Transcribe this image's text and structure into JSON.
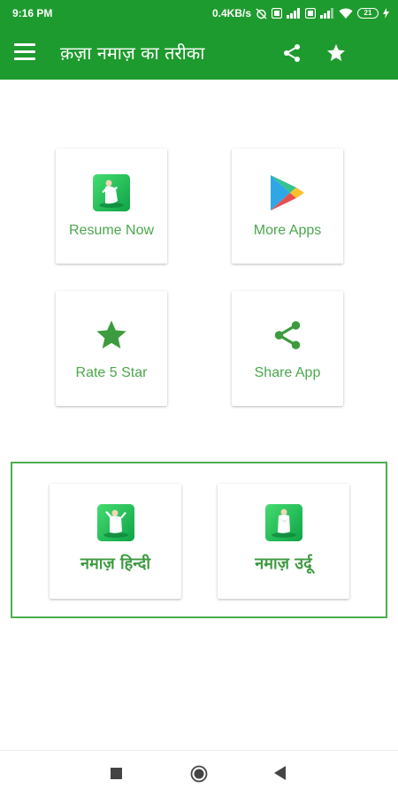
{
  "status_bar": {
    "time": "9:16 PM",
    "net_speed": "0.4KB/s",
    "battery": "21",
    "icons": [
      "alarm-off-icon",
      "hd-icon",
      "signal-icon",
      "hd-icon",
      "signal-icon",
      "wifi-icon",
      "battery-icon",
      "charging-icon"
    ]
  },
  "toolbar": {
    "title": "क़ज़ा नमाज़ का तरीका",
    "icons": [
      "menu-icon",
      "share-icon",
      "star-icon"
    ]
  },
  "cards": {
    "resume": {
      "label": "Resume Now",
      "icon": "prayer-icon"
    },
    "more_apps": {
      "label": "More Apps",
      "icon": "play-store-icon"
    },
    "rate": {
      "label": "Rate 5 Star",
      "icon": "star-icon"
    },
    "share": {
      "label": "Share App",
      "icon": "share-icon"
    }
  },
  "languages": {
    "hindi": {
      "label": "नमाज़ हिन्दी",
      "icon": "prayer-icon"
    },
    "urdu": {
      "label": "नमाज़ उर्दू",
      "icon": "prayer-icon"
    }
  },
  "nav_bar": {
    "icons": [
      "recents-icon",
      "home-icon",
      "back-icon"
    ]
  },
  "colors": {
    "primary": "#1e9b2e",
    "accent": "#4caf50",
    "label_text": "#4aa74c"
  }
}
